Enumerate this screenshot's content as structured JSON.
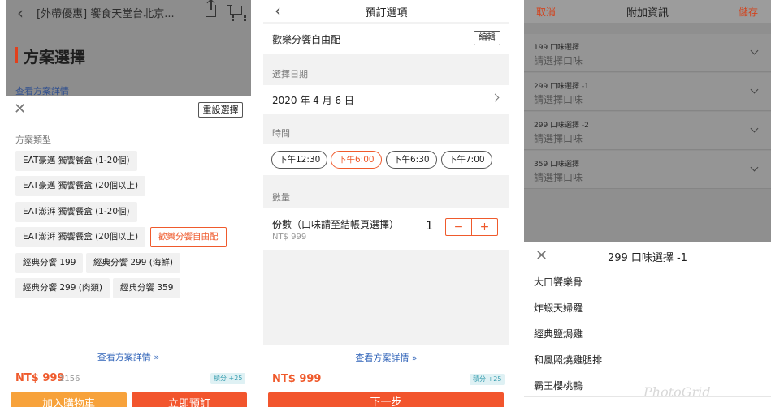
{
  "panel1": {
    "top_title": "[外帶優惠] 饗食天堂台北京...",
    "heading": "方案選擇",
    "view_plan_link_top": "查看方案詳情",
    "reset_label": "重設選擇",
    "type_label": "方案類型",
    "options": [
      {
        "label": "EAT豪邁 獨饗餐盒 (1-20個)"
      },
      {
        "label": "EAT豪邁 獨饗餐盒 (20個以上)"
      },
      {
        "label": "EAT澎湃 獨饗餐盒 (1-20個)"
      },
      {
        "label": "EAT澎湃 獨饗餐盒 (20個以上)"
      },
      {
        "label": "歡樂分饗自由配"
      },
      {
        "label": "經典分饗 199"
      },
      {
        "label": "經典分饗 299 (海鮮)"
      },
      {
        "label": "經典分饗 299 (肉類)"
      },
      {
        "label": "經典分饗 359"
      }
    ],
    "detail_link": "查看方案詳情 »",
    "price": "NT$ 999",
    "old_price": "1156",
    "points": "積分 +25",
    "add_cart_label": "加入購物車",
    "book_label": "立即預訂"
  },
  "panel2": {
    "title": "預訂選項",
    "package_name": "歡樂分饗自由配",
    "edit_label": "編輯",
    "date_label": "選擇日期",
    "date_value": "2020 年 4 月 6 日",
    "time_label": "時間",
    "times": [
      "下午12:30",
      "下午6:00",
      "下午6:30",
      "下午7:00"
    ],
    "qty_section_label": "數量",
    "qty_label": "份數（口味請至結帳頁選擇）",
    "qty_unit_price": "NT$ 999",
    "qty_value": "1",
    "minus": "−",
    "plus": "+",
    "detail_link": "查看方案詳情 »",
    "price": "NT$ 999",
    "points": "積分 +25",
    "next_label": "下一步"
  },
  "panel3": {
    "cancel": "取消",
    "title": "附加資訊",
    "save": "儲存",
    "flavors": [
      {
        "title": "199 口味選擇",
        "placeholder": "請選擇口味"
      },
      {
        "title": "299 口味選擇 -1",
        "placeholder": "請選擇口味"
      },
      {
        "title": "299 口味選擇 -2",
        "placeholder": "請選擇口味"
      },
      {
        "title": "359 口味選擇",
        "placeholder": "請選擇口味"
      }
    ],
    "sheet_title": "299 口味選擇 -1",
    "choices": [
      "大口饗樂骨",
      "炸蝦天婦羅",
      "經典鹽焗雞",
      "和風照燒雞腿排",
      "霸王櫻桃鴨"
    ]
  },
  "watermark": "PhotoGrid",
  "colors": {
    "accent": "#ef5a2c",
    "link": "#2e62b8",
    "cart": "#f7a23b"
  }
}
